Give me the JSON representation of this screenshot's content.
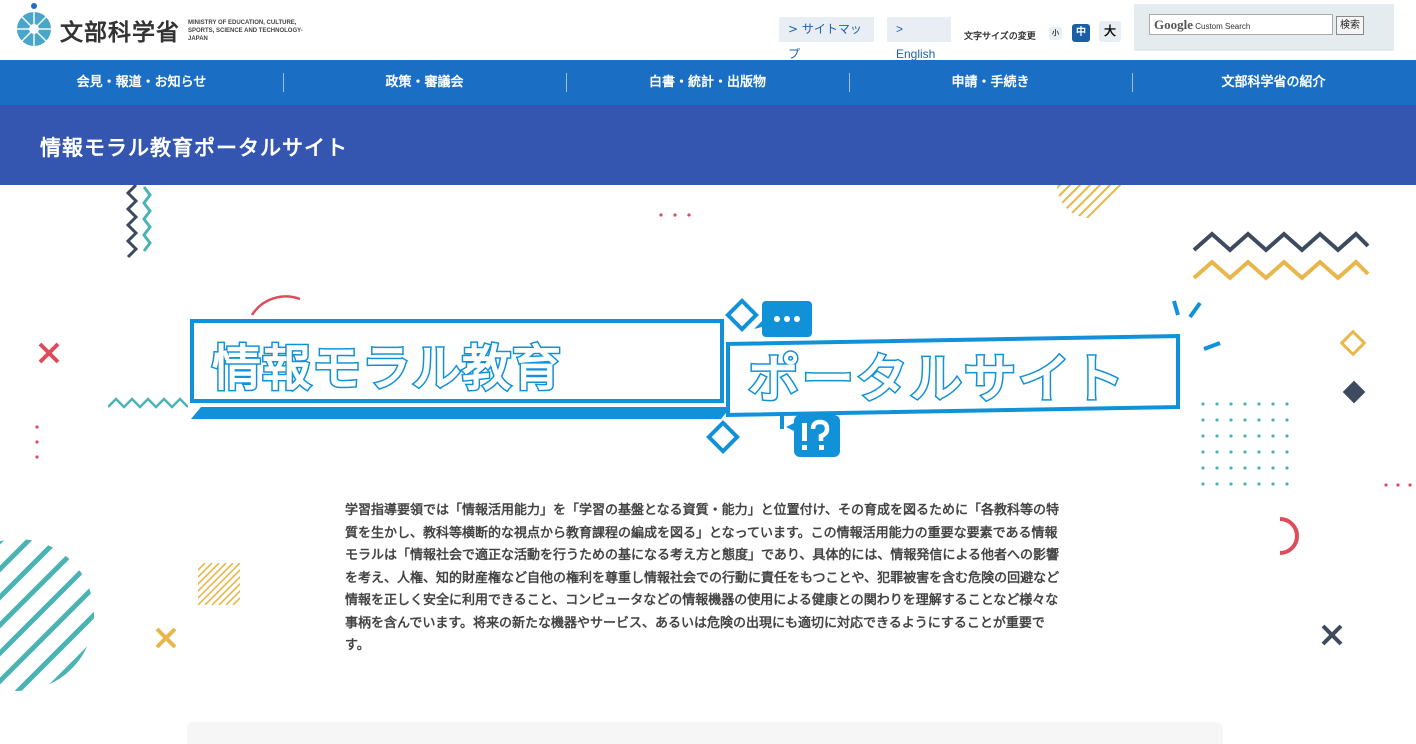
{
  "header": {
    "logo_name": "文部科学省",
    "logo_en": "MINISTRY OF EDUCATION, CULTURE, SPORTS, SCIENCE AND TECHNOLOGY-JAPAN",
    "sitemap_label": "> サイトマップ",
    "english_label": "> English",
    "font_size_label": "文字サイズの変更",
    "font_size_small": "小",
    "font_size_medium": "中",
    "font_size_large": "大",
    "search": {
      "brand": "Google",
      "placeholder": "Custom Search",
      "button_label": "検索"
    }
  },
  "global_nav": {
    "items": [
      {
        "label": "会見・報道・お知らせ"
      },
      {
        "label": "政策・審議会"
      },
      {
        "label": "白書・統計・出版物"
      },
      {
        "label": "申請・手続き"
      },
      {
        "label": "文部科学省の紹介"
      }
    ]
  },
  "page_title": "情報モラル教育ポータルサイト",
  "hero": {
    "banner_line1": "情報モラル教育",
    "banner_line2": "ポータルサイト",
    "intro_text": "学習指導要領では「情報活用能力」を「学習の基盤となる資質・能力」と位置付け、その育成を図るために「各教科等の特質を生かし、教科等横断的な視点から教育課程の編成を図る」となっています。この情報活用能力の重要な要素である情報モラルは「情報社会で適正な活動を行うための基になる考え方と態度」であり、具体的には、情報発信による他者への影響を考え、人権、知的財産権など自他の権利を尊重し情報社会での行動に責任をもつことや、犯罪被害を含む危険の回避など情報を正しく安全に利用できること、コンピュータなどの情報機器の使用による健康との関わりを理解することなど様々な事柄を含んでいます。将来の新たな機器やサービス、あるいは危険の出現にも適切に対応できるようにすることが重要です。"
  },
  "colors": {
    "nav_blue": "#1a6fc4",
    "title_blue": "#3456b0",
    "banner_blue": "#1192d8",
    "teal": "#4bb3b4",
    "yellow": "#e8b64a",
    "red": "#e04b5a",
    "navy": "#3e4a5e"
  }
}
